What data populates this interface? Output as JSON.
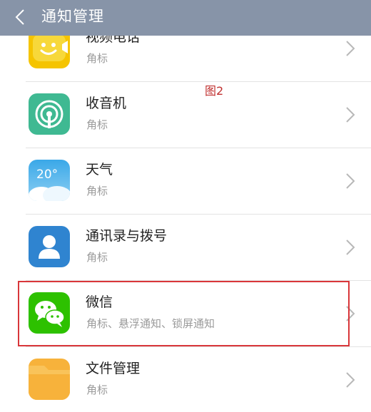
{
  "header": {
    "title": "通知管理"
  },
  "annotation": "图2",
  "apps": [
    {
      "name": "视频电话",
      "sub": "角标"
    },
    {
      "name": "收音机",
      "sub": "角标"
    },
    {
      "name": "天气",
      "sub": "角标",
      "icon_text": "20°"
    },
    {
      "name": "通讯录与拨号",
      "sub": "角标"
    },
    {
      "name": "微信",
      "sub": "角标、悬浮通知、锁屏通知"
    },
    {
      "name": "文件管理",
      "sub": "角标"
    }
  ],
  "colors": {
    "header": "#8794a8",
    "highlight": "#d9363a",
    "wechat": "#2dc100",
    "radio": "#3fb992",
    "contacts": "#2f84d0",
    "video": "#f5c400",
    "files": "#f7b23b"
  }
}
